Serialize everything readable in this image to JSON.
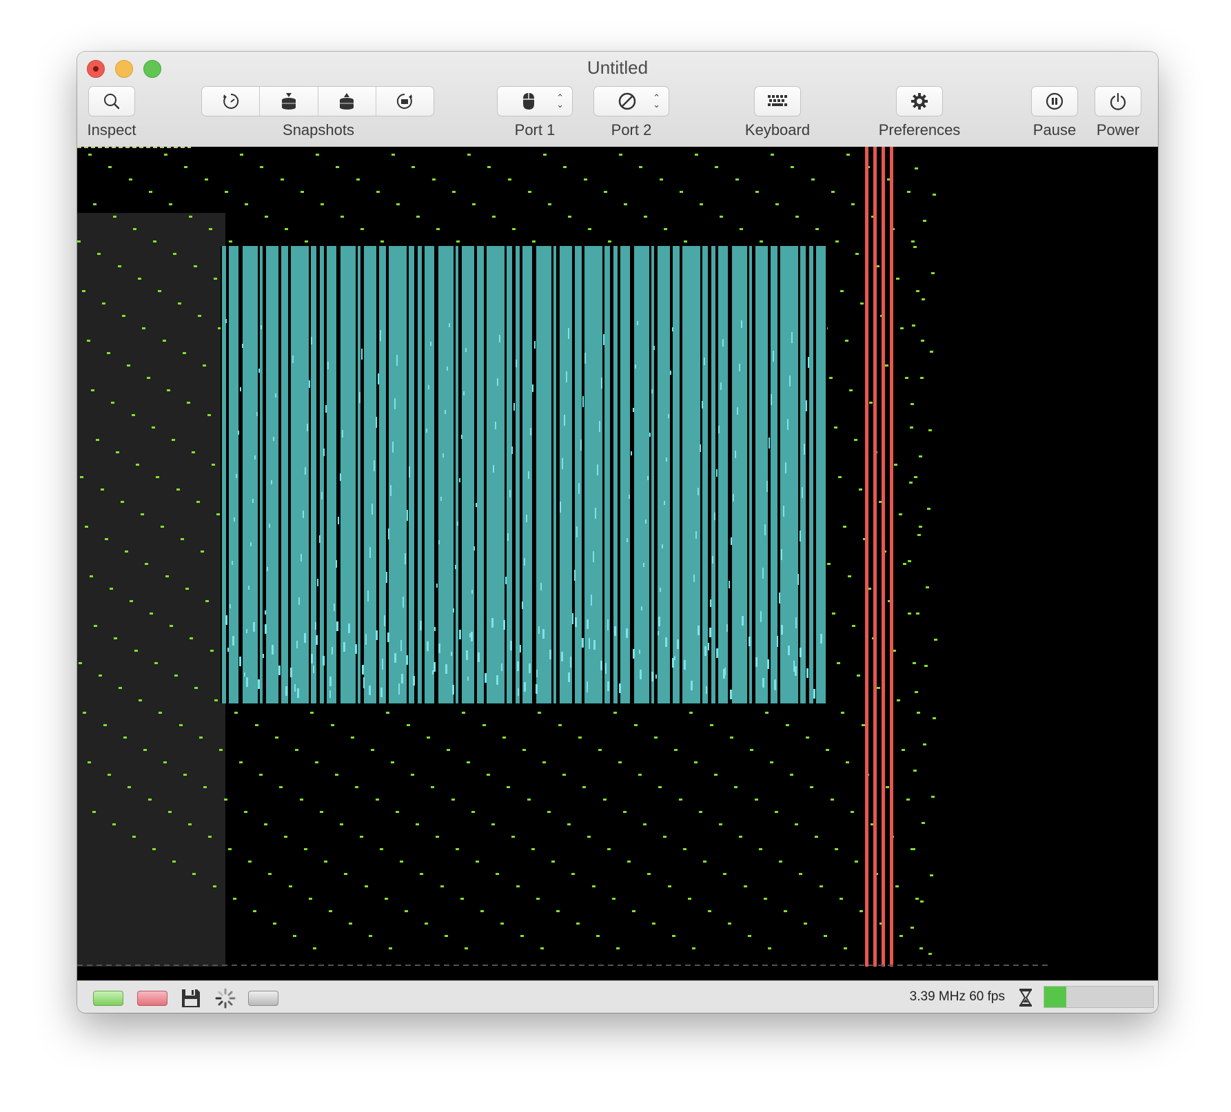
{
  "window": {
    "title": "Untitled"
  },
  "toolbar": {
    "inspect_label": "Inspect",
    "snapshots_label": "Snapshots",
    "port1_label": "Port 1",
    "port2_label": "Port 2",
    "keyboard_label": "Keyboard",
    "preferences_label": "Preferences",
    "pause_label": "Pause",
    "power_label": "Power"
  },
  "status": {
    "speed_text": "3.39 MHz 60 fps",
    "load_fraction": 0.2
  },
  "colors": {
    "screen_bg": "#000000",
    "left_panel": "#222222",
    "bars_cyan": "#4aa8a6",
    "bars_light": "#7de3e8",
    "dots_green": "#7fe12d",
    "stripes_red": "#e8574f"
  },
  "icons": {
    "inspect": "magnifier-icon",
    "snapshots": [
      "take-snapshot-icon",
      "push-snapshot-icon",
      "pop-snapshot-icon",
      "restore-snapshot-icon"
    ],
    "port1": "mouse-icon",
    "port2": "no-device-icon",
    "keyboard": "keyboard-icon",
    "preferences": "gear-icon",
    "pause": "pause-icon",
    "power": "power-icon",
    "status": [
      "power-led",
      "drive-led",
      "floppy-disk-icon",
      "spinner-icon",
      "cartridge-led",
      "hourglass-icon"
    ]
  }
}
